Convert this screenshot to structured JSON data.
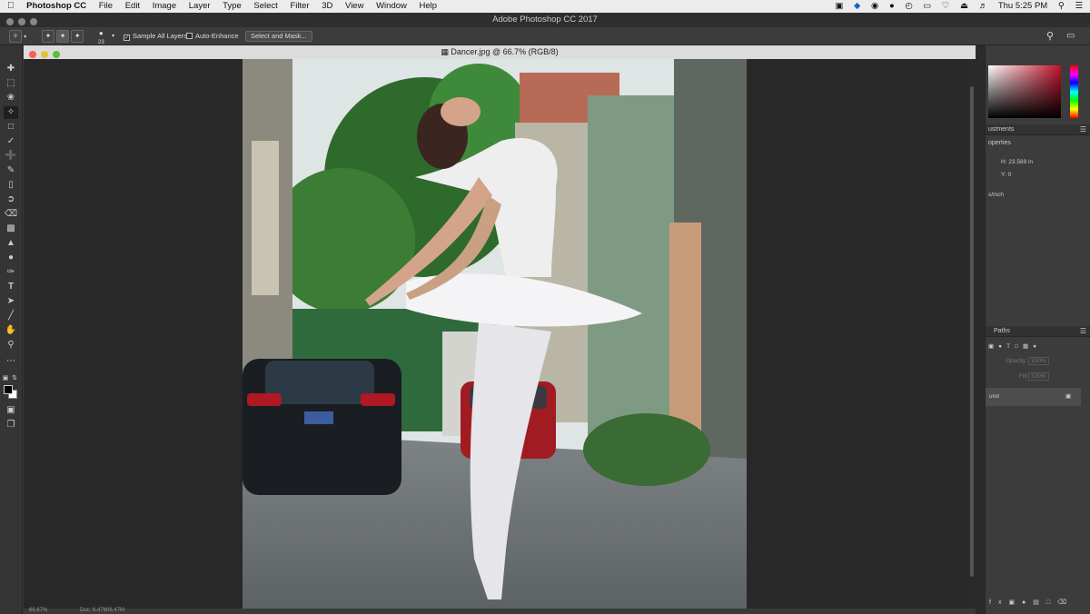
{
  "menubar": {
    "apple_icon": "apple-icon",
    "app_name": "Photoshop CC",
    "menus": [
      "File",
      "Edit",
      "Image",
      "Layer",
      "Type",
      "Select",
      "Filter",
      "3D",
      "View",
      "Window",
      "Help"
    ],
    "clock": "Thu 5:25 PM"
  },
  "window": {
    "title": "Adobe Photoshop CC 2017"
  },
  "options": {
    "brush_size": "23",
    "sample_all_layers": "Sample All Layers",
    "auto_enhance": "Auto-Enhance",
    "select_and_mask": "Select and Mask..."
  },
  "document": {
    "tab_title": "Dancer.jpg @ 66.7% (RGB/8)"
  },
  "status": {
    "zoom": "66.67%",
    "doc": "Doc: 6.47M/6.47M"
  },
  "panels": {
    "adjustments_label": "ustments",
    "properties_label": "operties",
    "h_value": "H: 23.569 in",
    "y_value": "Y: 0",
    "resolution": "s/inch",
    "paths_label": "Paths",
    "opacity_label": "Opacity:",
    "opacity_value": "100%",
    "fill_label": "Fill:",
    "fill_value": "100%",
    "layer_name": "und"
  },
  "colors": {
    "menubar_bg": "#ececec",
    "app_bg": "#3a3a3a",
    "picker_red": "#c4122a"
  }
}
